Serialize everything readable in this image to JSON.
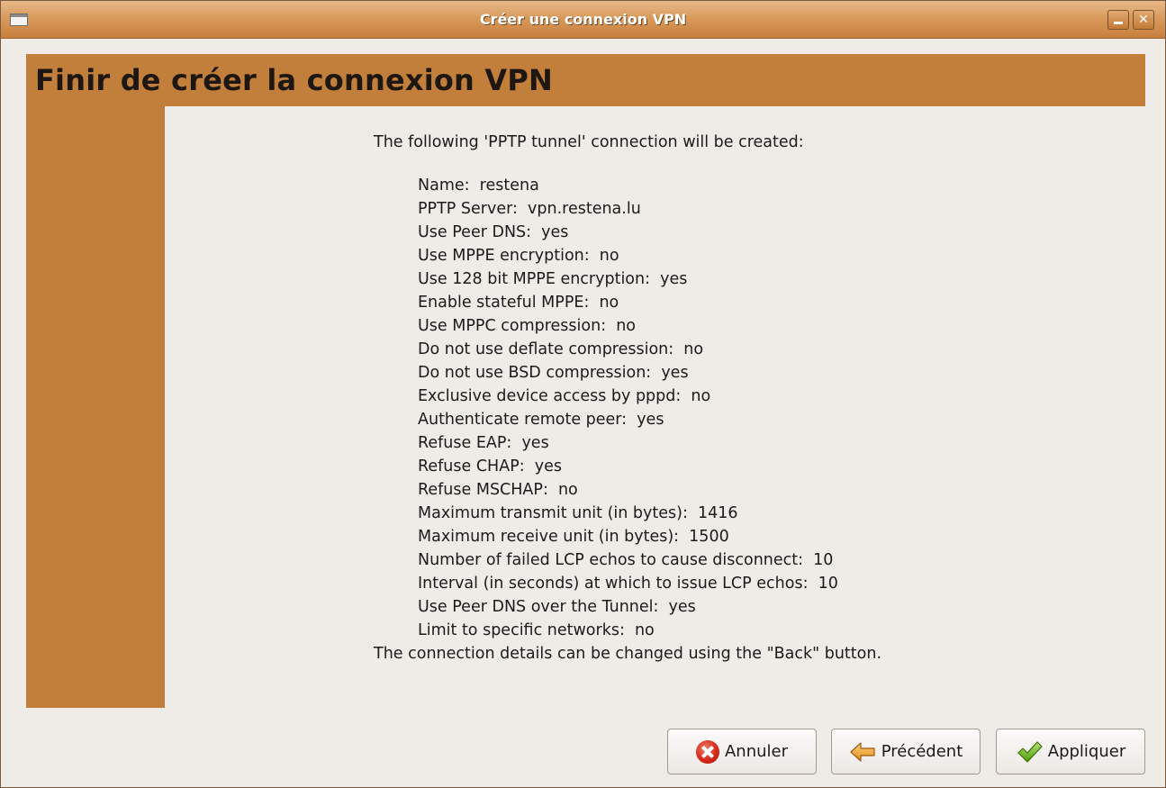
{
  "window": {
    "title": "Créer une connexion VPN"
  },
  "page": {
    "title": "Finir de créer la connexion VPN"
  },
  "summary": {
    "intro": "The following 'PPTP tunnel' connection will be created:",
    "details": [
      "Name:  restena",
      "PPTP Server:  vpn.restena.lu",
      "Use Peer DNS:  yes",
      "Use MPPE encryption:  no",
      "Use 128 bit MPPE encryption:  yes",
      "Enable stateful MPPE:  no",
      "Use MPPC compression:  no",
      "Do not use deflate compression:  no",
      "Do not use BSD compression:  yes",
      "Exclusive device access by pppd:  no",
      "Authenticate remote peer:  yes",
      "Refuse EAP:  yes",
      "Refuse CHAP:  yes",
      "Refuse MSCHAP:  no",
      "Maximum transmit unit (in bytes):  1416",
      "Maximum receive unit (in bytes):  1500",
      "Number of failed LCP echos to cause disconnect:  10",
      "Interval (in seconds) at which to issue LCP echos:  10",
      "Use Peer DNS over the Tunnel:  yes",
      "Limit to specific networks:  no"
    ],
    "outro": "The connection details can be changed using the \"Back\" button."
  },
  "buttons": {
    "cancel": {
      "label": "Annuler",
      "icon": "cancel-icon"
    },
    "back": {
      "label": "Précédent",
      "icon": "back-arrow-icon"
    },
    "apply": {
      "label": "Appliquer",
      "icon": "checkmark-icon"
    }
  },
  "colors": {
    "accent": "#c17f3b",
    "titlebar": "#d99b5c",
    "dialog_background": "#efebe7"
  }
}
